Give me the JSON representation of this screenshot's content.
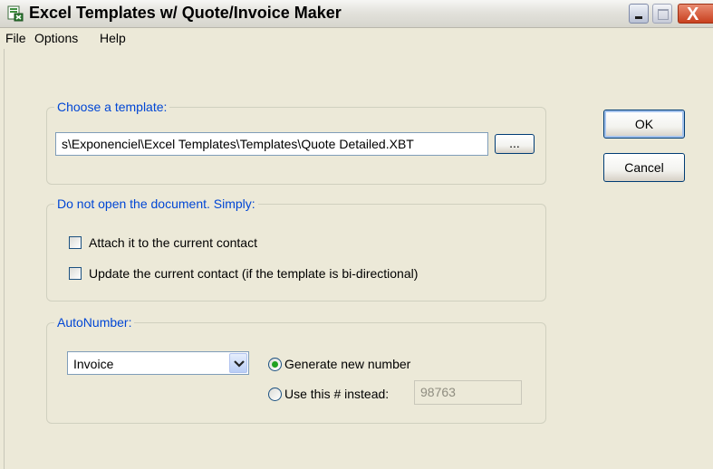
{
  "window": {
    "title": "Excel Templates w/ Quote/Invoice Maker",
    "icon": "excel-template-icon"
  },
  "title_buttons": {
    "minimize_icon": "minimize-icon",
    "maximize_icon": "maximize-icon",
    "close_label": "X"
  },
  "menu": {
    "items": [
      "File",
      "Options",
      "Help"
    ]
  },
  "template_group": {
    "legend": "Choose a template:",
    "path_value": "s\\Exponenciel\\Excel Templates\\Templates\\Quote Detailed.XBT",
    "browse_label": "..."
  },
  "open_group": {
    "legend": "Do not open the document. Simply:",
    "attach_label": "Attach it to the current contact",
    "attach_checked": false,
    "update_label": "Update the current contact (if the template is bi-directional)",
    "update_checked": false
  },
  "autonumber_group": {
    "legend": "AutoNumber:",
    "type_selected": "Invoice",
    "generate_label": "Generate new number",
    "generate_selected": true,
    "use_this_label": "Use this # instead:",
    "use_this_selected": false,
    "number_value": "98763"
  },
  "buttons": {
    "ok_label": "OK",
    "cancel_label": "Cancel"
  },
  "colors": {
    "legend_text": "#0046d5",
    "dialog_background": "#ece9d8",
    "close_button": "#c8401f"
  }
}
